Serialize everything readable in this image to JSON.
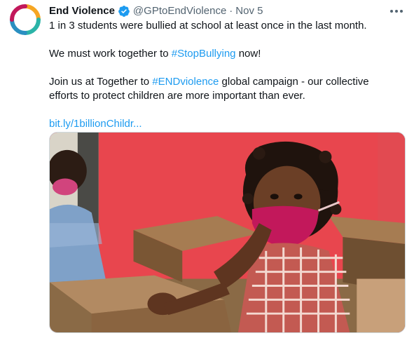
{
  "tweet": {
    "author_name": "End Violence",
    "handle": "@GPtoEndViolence",
    "separator": "·",
    "date": "Nov 5",
    "line1": "1 in 3 students were bullied at school at least once in the last month.",
    "line2_pre": "We must work together to ",
    "line2_tag": "#StopBullying",
    "line2_post": " now!",
    "line3_pre": "Join us at Together to ",
    "line3_tag": "#ENDviolence",
    "line3_post": " global campaign - our collective",
    "line4": "efforts to protect children are more important than ever.",
    "link": "bit.ly/1billionChildr..."
  },
  "icons": {
    "avatar": "end-violence-logo",
    "verified": "verified-badge-icon",
    "more": "more-options-icon"
  },
  "colors": {
    "accent": "#1d9bf0",
    "secondary_text": "#536471",
    "primary_text": "#0f1419",
    "photo_wall": "#e8464e"
  }
}
